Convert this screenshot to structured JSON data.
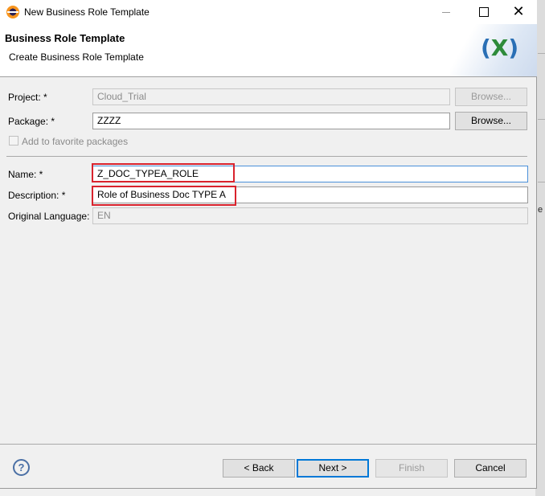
{
  "window": {
    "title": "New Business Role Template",
    "minimize_label": "",
    "maximize_label": "",
    "close_label": "✕"
  },
  "banner": {
    "title": "Business Role Template",
    "subtitle": "Create Business Role Template",
    "logo_text": "(X)"
  },
  "form": {
    "project": {
      "label": "Project: *",
      "value": "Cloud_Trial",
      "browse_label": "Browse..."
    },
    "package": {
      "label": "Package: *",
      "value": "ZZZZ",
      "browse_label": "Browse..."
    },
    "favorite": {
      "label": "Add to favorite packages",
      "checked": false
    },
    "name": {
      "label": "Name: *",
      "value": "Z_DOC_TYPEA_ROLE"
    },
    "description": {
      "label": "Description: *",
      "value": "Role of Business Doc TYPE A"
    },
    "original_language": {
      "label": "Original Language:",
      "value": "EN"
    }
  },
  "footer": {
    "help_icon": "?",
    "back_label": "< Back",
    "next_label": "Next >",
    "finish_label": "Finish",
    "cancel_label": "Cancel"
  },
  "background": {
    "edge_text": "e"
  },
  "colors": {
    "highlight": "#d9232d",
    "focus": "#0078d7"
  }
}
